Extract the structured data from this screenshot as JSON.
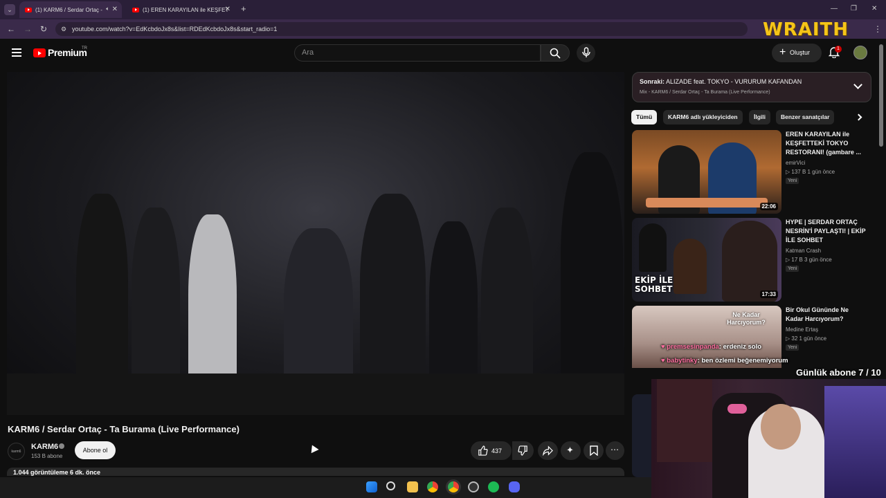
{
  "browser": {
    "tabs": [
      {
        "label": "(1) KARM6 / Serdar Ortaç -",
        "active": true
      },
      {
        "label": "(1) EREN KARAYILAN ile KEŞFET",
        "active": false
      }
    ],
    "new_tab": "+",
    "url": "youtube.com/watch?v=EdKcbdoJx8s&list=RDEdKcbdoJx8s&start_radio=1"
  },
  "overlay": {
    "wraith": "WRAITH",
    "daily_subs": "Günlük abone 7 / 10",
    "chat": [
      {
        "user": "premsesinpanda",
        "text": ": erdeniz solo"
      },
      {
        "user": "babytinky",
        "text": ": ben özlemi beğenemiyorum"
      }
    ]
  },
  "header": {
    "logo": "Premium",
    "region": "TR",
    "search_placeholder": "Ara",
    "create_label": "Oluştur",
    "notif_count": "1"
  },
  "video": {
    "title": "KARM6 / Serdar Ortaç - Ta Burama (Live Performance)",
    "channel": "KARM6",
    "channel_avatar_text": "karm6",
    "subscribers": "153 B abone",
    "subscribe_label": "Abone ol",
    "likes": "437",
    "views_line": "1.044 görüntüleme  6 dk. önce"
  },
  "sidebar": {
    "next_prefix": "Sonraki:",
    "next_title": "ALIZADE feat. TOKYO - VURURUM KAFANDAN",
    "mix_line": "Mix - KARM6 / Serdar Ortaç - Ta Burama (Live Performance)",
    "chips": [
      "Tümü",
      "KARM6 adlı yükleyiciden",
      "İlgili",
      "Benzer sanatçılar"
    ],
    "items": [
      {
        "title": "EREN KARAYILAN ile KEŞFETTEKİ TOKYO RESTORANI! (gambare ...",
        "channel": "emirVici",
        "meta": "▷ 137 B   1 gün önce",
        "badge": "Yeni",
        "duration": "22:06"
      },
      {
        "title": "HYPE | SERDAR ORTAÇ NESRİN'İ PAYLAŞTI! | EKİP İLE SOHBET",
        "channel": "Katman Crash",
        "meta": "▷ 17 B   3 gün önce",
        "badge": "Yeni",
        "duration": "17:33",
        "thumb_text": "EKİP İLE SOHBET"
      },
      {
        "title": "Bir Okul Gününde Ne Kadar Harcıyorum?",
        "channel": "Medine Ertaş",
        "meta": "▷ 32   1 gün önce",
        "badge": "Yeni",
        "thumb_text": "Ne Kadar Harcıyorum?"
      }
    ]
  },
  "colors": {
    "accent": "#ff0000",
    "background": "#0f0f0f",
    "wraith": "#f5c518"
  }
}
